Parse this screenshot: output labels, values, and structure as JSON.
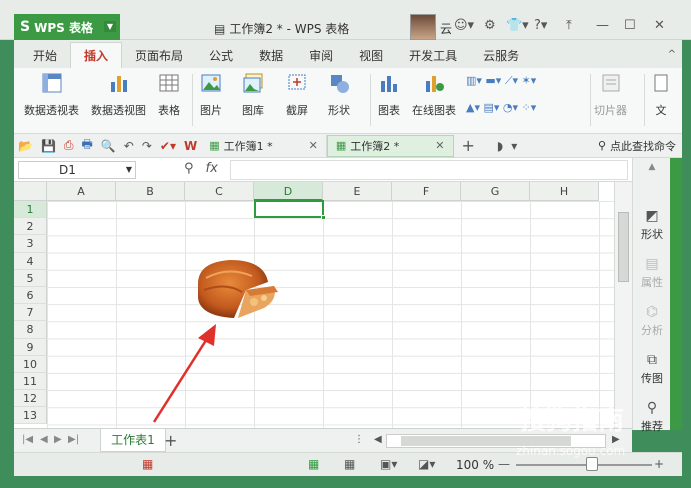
{
  "app": {
    "name": "WPS 表格",
    "doc_title": "工作簿2 * - WPS 表格",
    "user": "云"
  },
  "ribbon_tabs": [
    "开始",
    "插入",
    "页面布局",
    "公式",
    "数据",
    "审阅",
    "视图",
    "开发工具",
    "云服务"
  ],
  "active_tab": "插入",
  "ribbon": {
    "pivot_table": "数据透视表",
    "pivot_chart": "数据透视图",
    "table": "表格",
    "picture": "图片",
    "gallery": "图库",
    "screenshot": "截屏",
    "shape": "形状",
    "chart": "图表",
    "online_chart": "在线图表",
    "slicer": "切片器",
    "text": "文"
  },
  "doc_tabs": [
    {
      "label": "工作簿1 *"
    },
    {
      "label": "工作簿2 *"
    }
  ],
  "search_label": "点此查找命令",
  "name_box": "D1",
  "fx_label": "fx",
  "columns": [
    "A",
    "B",
    "C",
    "D",
    "E",
    "F",
    "G",
    "H"
  ],
  "rows": [
    "1",
    "2",
    "3",
    "4",
    "5",
    "6",
    "7",
    "8",
    "9",
    "10",
    "11",
    "12",
    "13"
  ],
  "right_panel": {
    "shape": "形状",
    "property": "属性",
    "analysis": "分析",
    "transfer": "传图",
    "push": "推荐"
  },
  "sheet_tab": "工作表1",
  "zoom": "100 %",
  "watermark": "搜狗指南",
  "watermark_url": "zhinan.sogou.com",
  "colors": {
    "brand": "#3d9a44",
    "active_tab": "#c0392b",
    "selection": "#2f9b40",
    "arrow": "#e0302a"
  }
}
